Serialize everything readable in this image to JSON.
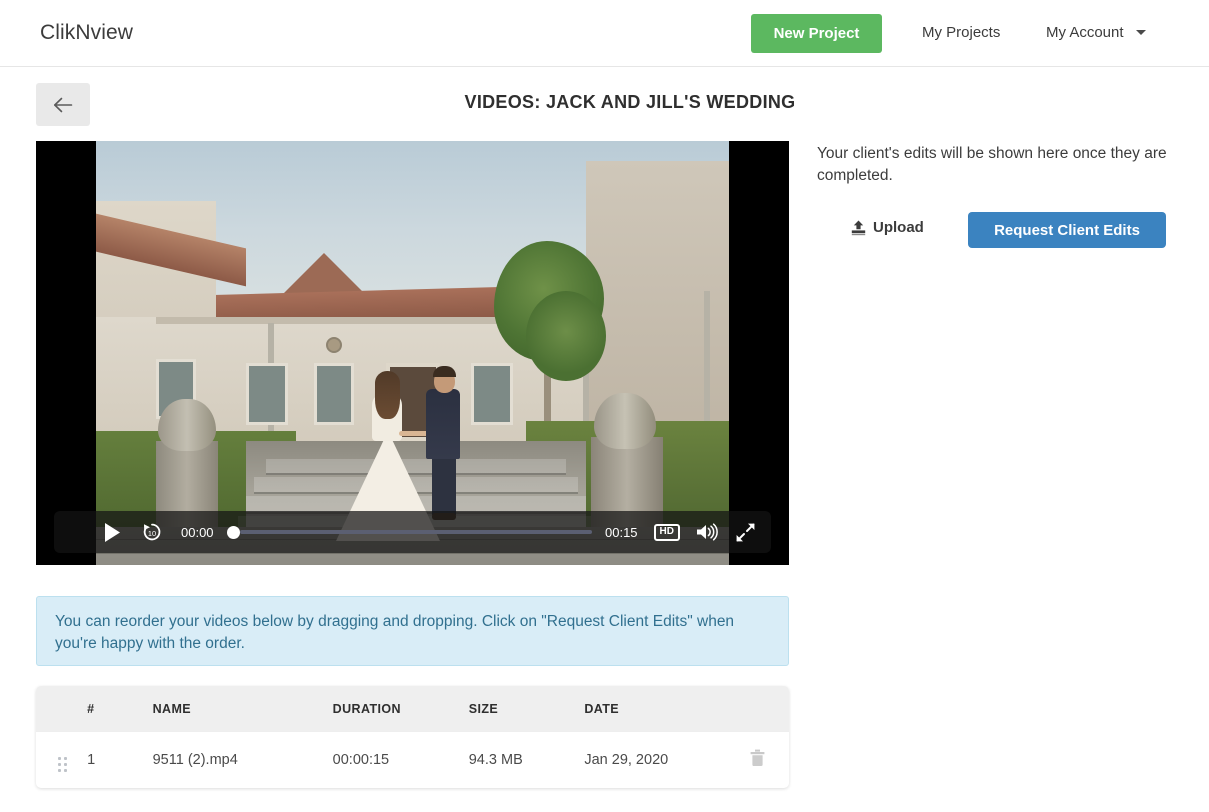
{
  "navbar": {
    "brand": "ClikNview",
    "new_project_label": "New Project",
    "my_projects_label": "My Projects",
    "my_account_label": "My Account",
    "new_project_color": "#5cb860"
  },
  "page": {
    "back_icon": "arrow-left-icon",
    "title": "VIDEOS: JACK AND JILL'S WEDDING"
  },
  "player": {
    "play_icon": "play-icon",
    "rewind_icon": "rewind-10-icon",
    "current_time": "00:00",
    "total_time": "00:15",
    "quality_label": "HD",
    "volume_icon": "volume-icon",
    "fullscreen_icon": "fullscreen-icon",
    "progress_percent": 0
  },
  "sidebar": {
    "message": "Your client's edits will be shown here once they are completed.",
    "upload_label": "Upload",
    "upload_icon": "upload-icon",
    "request_label": "Request Client Edits",
    "request_color": "#3b83c0"
  },
  "banner": {
    "text": "You can reorder your videos below by dragging and dropping. Click on \"Request Client Edits\" when you're happy with the order.",
    "background": "#d9edf7",
    "text_color": "#31708f"
  },
  "table": {
    "headers": {
      "num": "#",
      "name": "NAME",
      "duration": "DURATION",
      "size": "SIZE",
      "date": "DATE"
    },
    "rows": [
      {
        "num": "1",
        "name": "9511 (2).mp4",
        "duration": "00:00:15",
        "size": "94.3 MB",
        "date": "Jan 29, 2020",
        "handle_icon": "drag-handle-icon",
        "delete_icon": "trash-icon"
      }
    ]
  }
}
